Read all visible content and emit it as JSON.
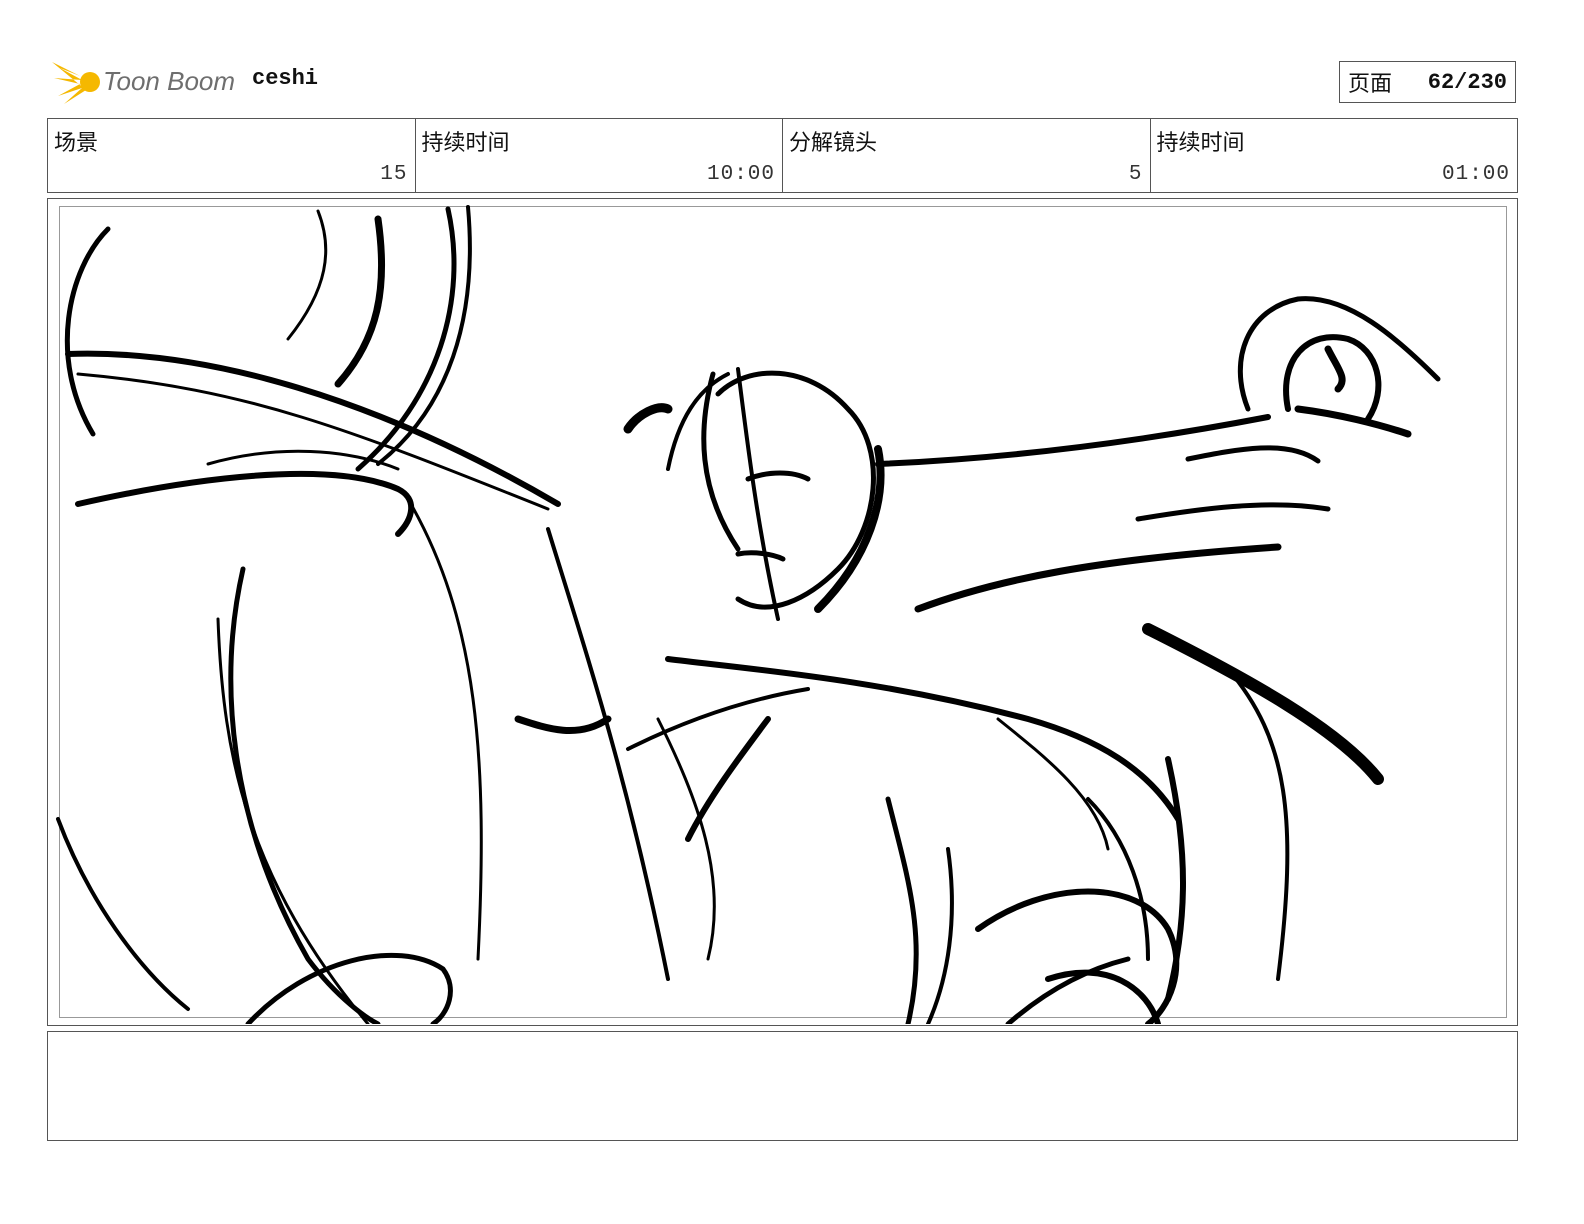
{
  "header": {
    "logo_text": "Toon Boom",
    "project_name": "ceshi",
    "page_label": "页面",
    "page_number": "62/230"
  },
  "info": {
    "scene_label": "场景",
    "scene_value": "15",
    "scene_duration_label": "持续时间",
    "scene_duration_value": "10:00",
    "panel_label": "分解镜头",
    "panel_value": "5",
    "panel_duration_label": "持续时间",
    "panel_duration_value": "01:00"
  },
  "panel": {
    "image": "rough-sketch-character-punch"
  },
  "notes": {
    "text": ""
  },
  "colors": {
    "logo_star": "#f5b800",
    "logo_text": "#6e6e6e",
    "border": "#555555",
    "ink": "#000000"
  }
}
